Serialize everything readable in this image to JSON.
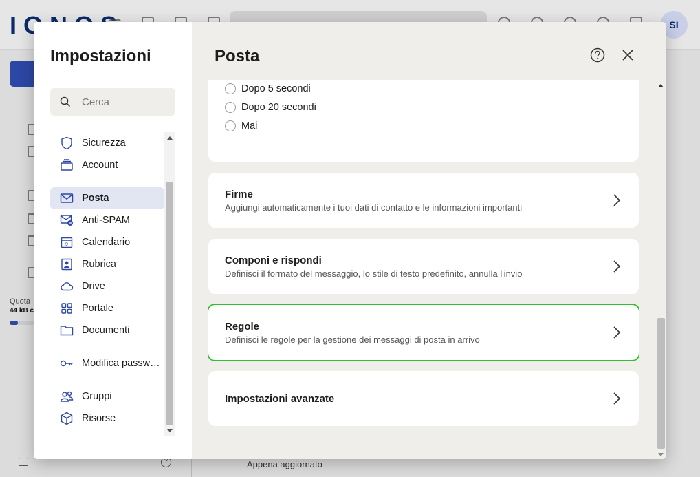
{
  "background": {
    "logo": "IONOS",
    "avatar_initials": "SI",
    "quota_label": "Quota",
    "quota_value": "44 kB c",
    "footer_status": "Appena aggiornato"
  },
  "settings": {
    "title": "Impostazioni",
    "search_placeholder": "Cerca",
    "nav": [
      {
        "label": "Sicurezza",
        "icon": "shield-icon"
      },
      {
        "label": "Account",
        "icon": "account-icon"
      },
      {
        "label": "Posta",
        "icon": "mail-icon",
        "active": true
      },
      {
        "label": "Anti-SPAM",
        "icon": "antispam-icon"
      },
      {
        "label": "Calendario",
        "icon": "calendar-icon"
      },
      {
        "label": "Rubrica",
        "icon": "contacts-icon"
      },
      {
        "label": "Drive",
        "icon": "cloud-icon"
      },
      {
        "label": "Portale",
        "icon": "grid-icon"
      },
      {
        "label": "Documenti",
        "icon": "folder-icon"
      },
      {
        "label": "Modifica password",
        "icon": "key-icon"
      },
      {
        "label": "Gruppi",
        "icon": "group-icon"
      },
      {
        "label": "Risorse",
        "icon": "cube-icon"
      }
    ]
  },
  "main": {
    "title": "Posta",
    "radio_options": [
      "Dopo 5 secondi",
      "Dopo 20 secondi",
      "Mai"
    ],
    "cards": [
      {
        "title": "Firme",
        "description": "Aggiungi automaticamente i tuoi dati di contatto e le informazioni importanti"
      },
      {
        "title": "Componi e rispondi",
        "description": "Definisci il formato del messaggio, lo stile di testo predefinito, annulla l'invio"
      },
      {
        "title": "Regole",
        "description": "Definisci le regole per la gestione dei messaggi di posta in arrivo"
      },
      {
        "title": "Impostazioni avanzate",
        "description": ""
      }
    ]
  },
  "colors": {
    "accent": "#2d47a5",
    "active_nav_bg": "#e2e5f2",
    "highlight": "#2ec12e",
    "panel_bg": "#efeeeb"
  }
}
